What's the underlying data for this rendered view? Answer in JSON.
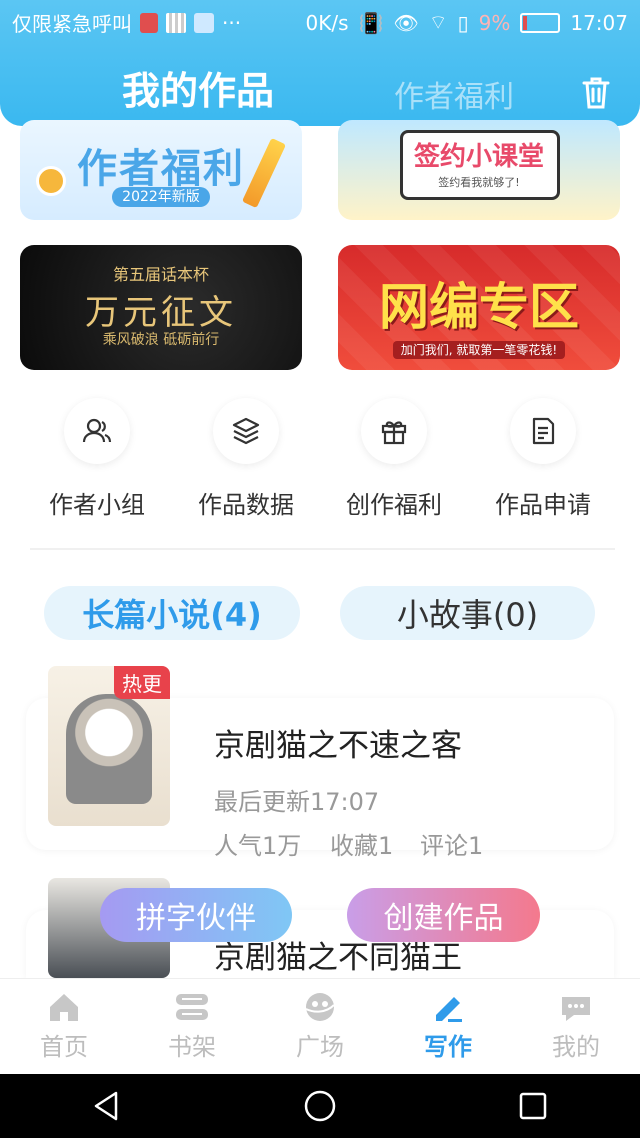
{
  "status_bar": {
    "carrier": "仅限紧急呼叫",
    "net_speed": "0K/s",
    "battery_pct": "9%",
    "time": "17:07"
  },
  "header": {
    "tab_active": "我的作品",
    "tab_inactive": "作者福利",
    "trash_icon": "trash-icon"
  },
  "banners": [
    {
      "title": "作者福利",
      "subtitle": "2022年新版"
    },
    {
      "title": "签约小课堂",
      "subtitle": "签约看我就够了!"
    },
    {
      "title": "万元征文",
      "top": "第五届话本杯",
      "subtitle": "乘风破浪 砥砺前行"
    },
    {
      "title": "网编专区",
      "subtitle": "加门我们, 就取第一笔零花钱!"
    }
  ],
  "quick_links": [
    {
      "label": "作者小组",
      "icon": "users-icon"
    },
    {
      "label": "作品数据",
      "icon": "layers-icon"
    },
    {
      "label": "创作福利",
      "icon": "gift-icon"
    },
    {
      "label": "作品申请",
      "icon": "document-icon"
    }
  ],
  "filter_tabs": {
    "long": "长篇小说(4)",
    "short": "小故事(0)"
  },
  "works": [
    {
      "badge": "热更",
      "title": "京剧猫之不速之客",
      "last_update": "最后更新17:07",
      "popularity": "人气1万",
      "favorites": "收藏1",
      "comments": "评论1"
    },
    {
      "title": "京剧猫之不同猫王"
    }
  ],
  "floating_buttons": {
    "partner": "拼字伙伴",
    "create": "创建作品"
  },
  "bottom_nav": [
    {
      "label": "首页",
      "icon": "home-icon"
    },
    {
      "label": "书架",
      "icon": "bookshelf-icon"
    },
    {
      "label": "广场",
      "icon": "plaza-icon"
    },
    {
      "label": "写作",
      "icon": "pen-icon",
      "active": true
    },
    {
      "label": "我的",
      "icon": "chat-icon"
    }
  ],
  "colors": {
    "accent": "#2f9bea",
    "header": "#3ab8f0",
    "hot": "#e8424b"
  }
}
